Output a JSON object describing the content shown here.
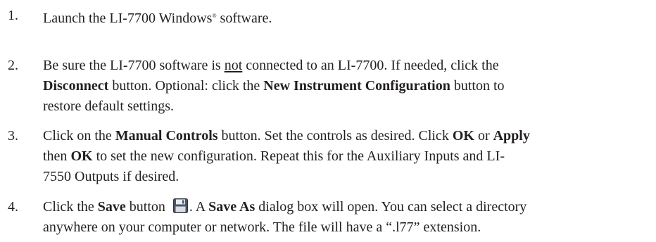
{
  "steps": [
    {
      "number": "1.",
      "a": "Launch the LI-7700 Windows",
      "reg": "®",
      "b": " software."
    },
    {
      "number": "2.",
      "line1_a": "Be sure the LI-7700 software is ",
      "line1_not": "not",
      "line1_b": " connected to an LI-7700. If needed, click the",
      "line2_disconnect": "Disconnect",
      "line2_a": " button. Optional: click the ",
      "line2_newconfig": "New Instrument Configuration",
      "line2_b": " button to",
      "line3": "restore default settings."
    },
    {
      "number": "3.",
      "line1_a": "Click on the ",
      "line1_manual": "Manual Controls",
      "line1_b": " button. Set the controls as desired. Click ",
      "line1_ok": "OK",
      "line1_or": " or ",
      "line1_apply": "Apply",
      "line2_ok": "OK",
      "line2_a": " to set the new configuration. Repeat this for the Auxiliary Inputs and LI-",
      "line3": "7550 Outputs if desired."
    },
    {
      "number": "4.",
      "line1_a": "Click the ",
      "line1_save": "Save",
      "line1_b": " button ",
      "line1_c": ". A ",
      "line1_saveas": "Save As",
      "line1_d": " dialog box will open. You can select a directory",
      "line2": "anywhere on your computer or network. The file will have a “.l77” extension."
    }
  ],
  "icons": {
    "save": "floppy-disk-icon"
  },
  "colors": {
    "text": "#231f20",
    "icon_body": "#4a5563"
  }
}
